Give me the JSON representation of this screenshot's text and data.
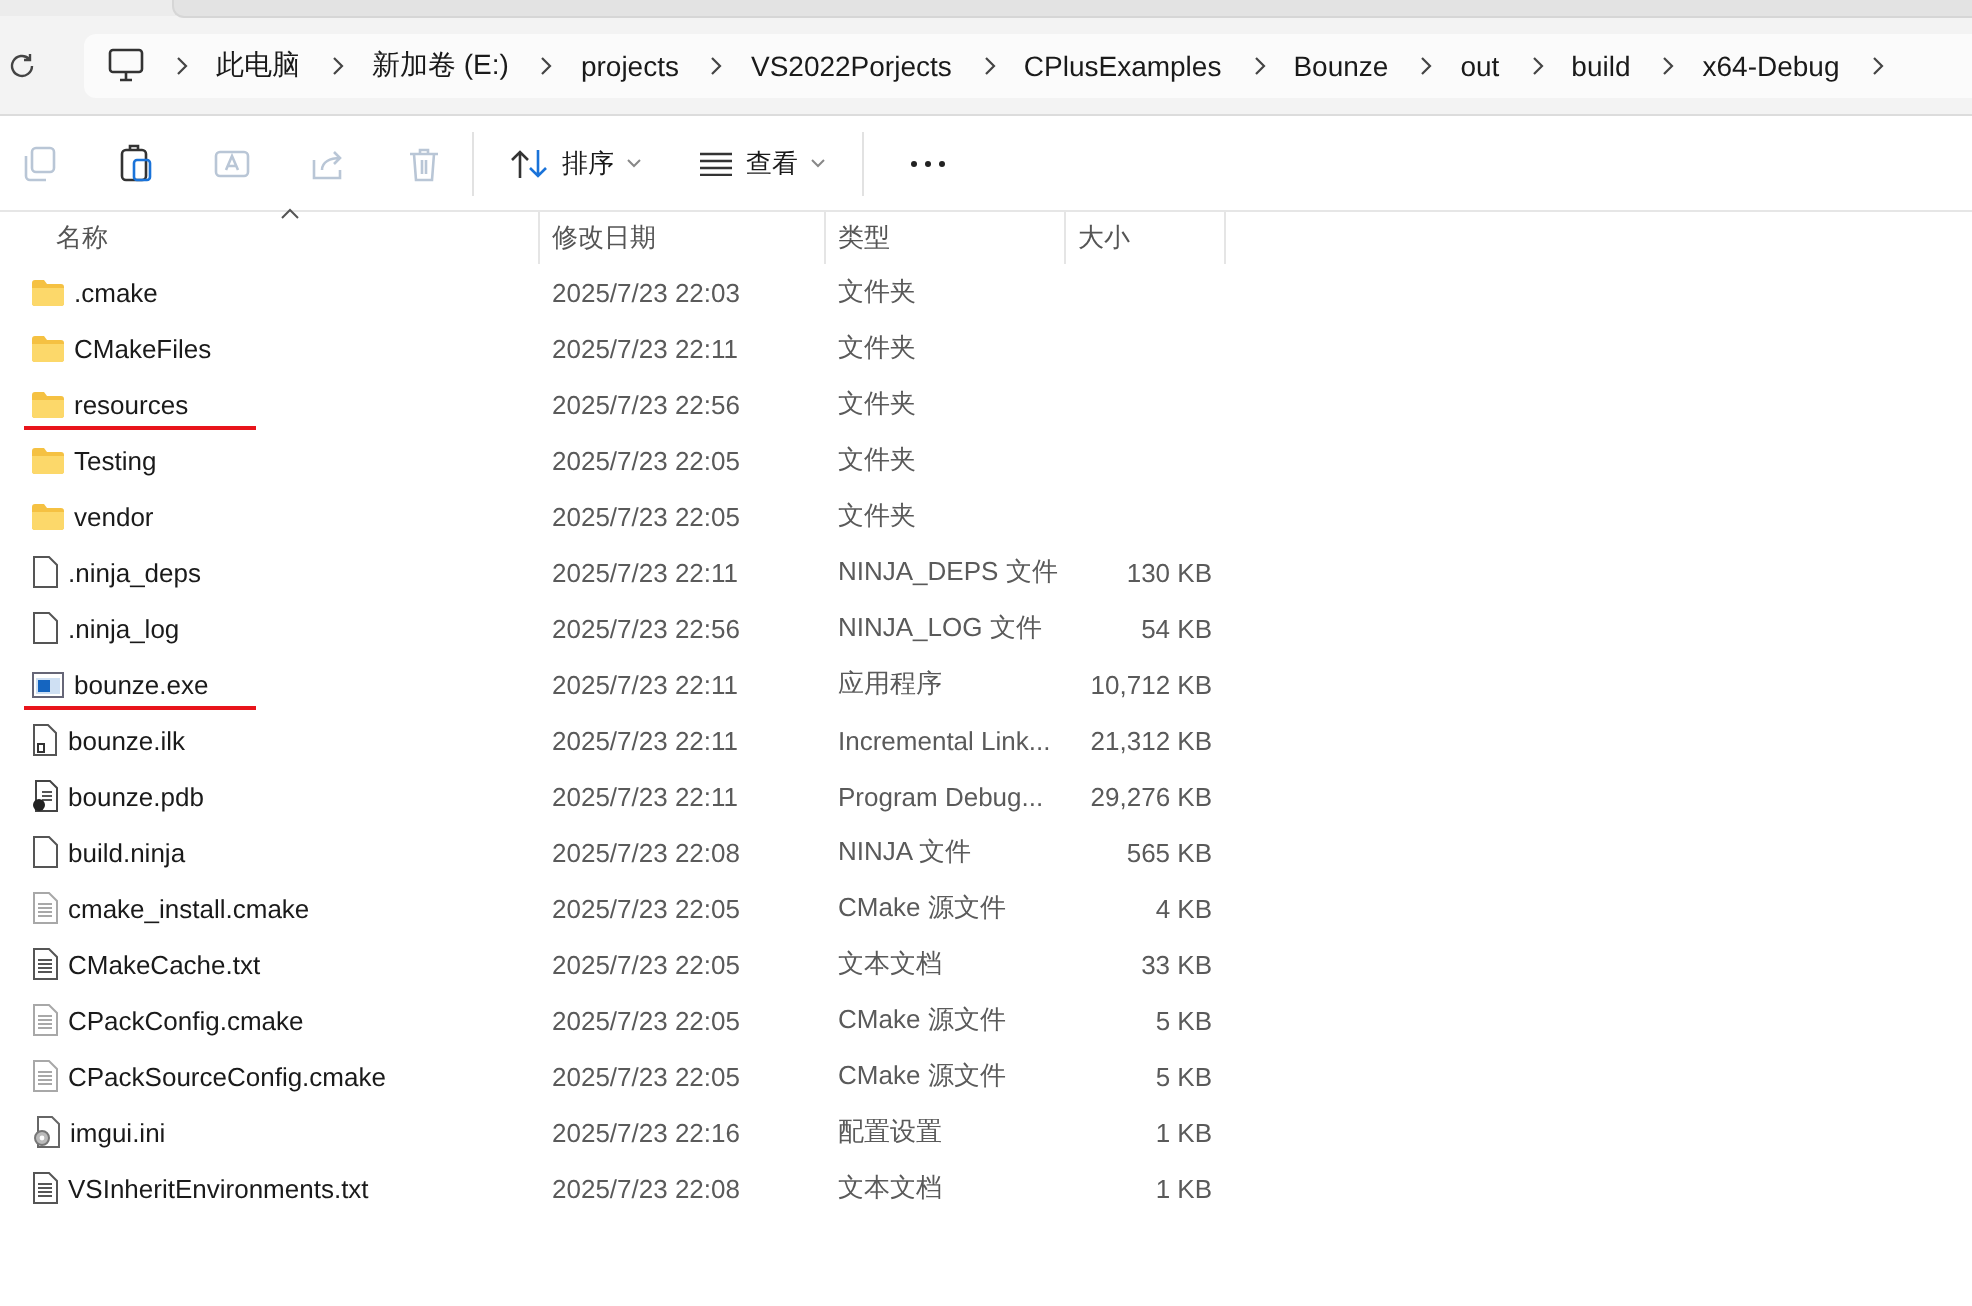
{
  "address_bar": {
    "crumbs": [
      "此电脑",
      "新加卷 (E:)",
      "projects",
      "VS2022Porjects",
      "CPlusExamples",
      "Bounze",
      "out",
      "build",
      "x64-Debug"
    ]
  },
  "toolbar": {
    "actions": [
      {
        "kind": "copy",
        "disabled": true
      },
      {
        "kind": "paste",
        "disabled": false
      },
      {
        "kind": "rename",
        "disabled": true
      },
      {
        "kind": "share",
        "disabled": true
      },
      {
        "kind": "delete",
        "disabled": true
      }
    ],
    "sort": {
      "label": "排序"
    },
    "view": {
      "label": "查看"
    }
  },
  "table": {
    "columns": [
      "名称",
      "修改日期",
      "类型",
      "大小"
    ],
    "rows": [
      {
        "name": ".cmake",
        "date": "2025/7/23 22:03",
        "type": "文件夹",
        "size": "",
        "kind": "folder",
        "marked": false
      },
      {
        "name": "CMakeFiles",
        "date": "2025/7/23 22:11",
        "type": "文件夹",
        "size": "",
        "kind": "folder",
        "marked": false
      },
      {
        "name": "resources",
        "date": "2025/7/23 22:56",
        "type": "文件夹",
        "size": "",
        "kind": "folder",
        "marked": true
      },
      {
        "name": "Testing",
        "date": "2025/7/23 22:05",
        "type": "文件夹",
        "size": "",
        "kind": "folder",
        "marked": false
      },
      {
        "name": "vendor",
        "date": "2025/7/23 22:05",
        "type": "文件夹",
        "size": "",
        "kind": "folder",
        "marked": false
      },
      {
        "name": ".ninja_deps",
        "date": "2025/7/23 22:11",
        "type": "NINJA_DEPS 文件",
        "size": "130 KB",
        "kind": "blank",
        "marked": false
      },
      {
        "name": ".ninja_log",
        "date": "2025/7/23 22:56",
        "type": "NINJA_LOG 文件",
        "size": "54 KB",
        "kind": "blank",
        "marked": false
      },
      {
        "name": "bounze.exe",
        "date": "2025/7/23 22:11",
        "type": "应用程序",
        "size": "10,712 KB",
        "kind": "app",
        "marked": true
      },
      {
        "name": "bounze.ilk",
        "date": "2025/7/23 22:11",
        "type": "Incremental Link...",
        "size": "21,312 KB",
        "kind": "linked",
        "marked": false
      },
      {
        "name": "bounze.pdb",
        "date": "2025/7/23 22:11",
        "type": "Program Debug...",
        "size": "29,276 KB",
        "kind": "pdb",
        "marked": false
      },
      {
        "name": "build.ninja",
        "date": "2025/7/23 22:08",
        "type": "NINJA 文件",
        "size": "565 KB",
        "kind": "blank",
        "marked": false
      },
      {
        "name": "cmake_install.cmake",
        "date": "2025/7/23 22:05",
        "type": "CMake 源文件",
        "size": "4 KB",
        "kind": "source",
        "marked": false
      },
      {
        "name": "CMakeCache.txt",
        "date": "2025/7/23 22:05",
        "type": "文本文档",
        "size": "33 KB",
        "kind": "text",
        "marked": false
      },
      {
        "name": "CPackConfig.cmake",
        "date": "2025/7/23 22:05",
        "type": "CMake 源文件",
        "size": "5 KB",
        "kind": "source",
        "marked": false
      },
      {
        "name": "CPackSourceConfig.cmake",
        "date": "2025/7/23 22:05",
        "type": "CMake 源文件",
        "size": "5 KB",
        "kind": "source",
        "marked": false
      },
      {
        "name": "imgui.ini",
        "date": "2025/7/23 22:16",
        "type": "配置设置",
        "size": "1 KB",
        "kind": "config",
        "marked": false
      },
      {
        "name": "VSInheritEnvironments.txt",
        "date": "2025/7/23 22:08",
        "type": "文本文档",
        "size": "1 KB",
        "kind": "text",
        "marked": false
      }
    ]
  }
}
